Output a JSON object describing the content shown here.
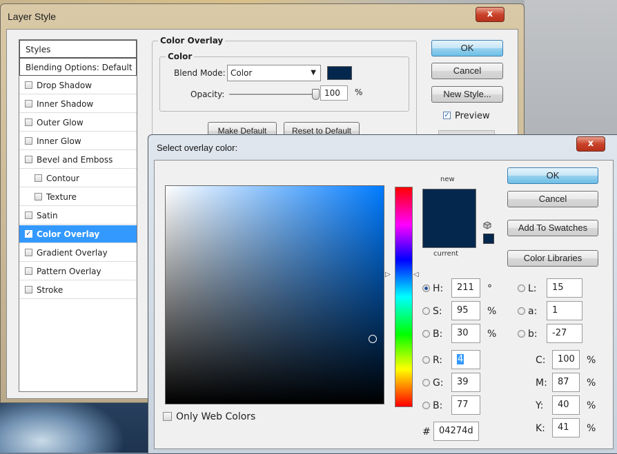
{
  "layer_style": {
    "title": "Layer Style",
    "close_label": "x",
    "styles": [
      {
        "label": "Styles",
        "checkbox": false,
        "checked": false,
        "indent": false,
        "header": true
      },
      {
        "label": "Blending Options: Default",
        "checkbox": false,
        "checked": false,
        "indent": false,
        "header": true
      },
      {
        "label": "Drop Shadow",
        "checkbox": true,
        "checked": false,
        "indent": false
      },
      {
        "label": "Inner Shadow",
        "checkbox": true,
        "checked": false,
        "indent": false
      },
      {
        "label": "Outer Glow",
        "checkbox": true,
        "checked": false,
        "indent": false
      },
      {
        "label": "Inner Glow",
        "checkbox": true,
        "checked": false,
        "indent": false
      },
      {
        "label": "Bevel and Emboss",
        "checkbox": true,
        "checked": false,
        "indent": false
      },
      {
        "label": "Contour",
        "checkbox": true,
        "checked": false,
        "indent": true
      },
      {
        "label": "Texture",
        "checkbox": true,
        "checked": false,
        "indent": true
      },
      {
        "label": "Satin",
        "checkbox": true,
        "checked": false,
        "indent": false
      },
      {
        "label": "Color Overlay",
        "checkbox": true,
        "checked": true,
        "indent": false,
        "active": true
      },
      {
        "label": "Gradient Overlay",
        "checkbox": true,
        "checked": false,
        "indent": false
      },
      {
        "label": "Pattern Overlay",
        "checkbox": true,
        "checked": false,
        "indent": false
      },
      {
        "label": "Stroke",
        "checkbox": true,
        "checked": false,
        "indent": false
      }
    ],
    "section_title": "Color Overlay",
    "group_title": "Color",
    "blend_mode_label": "Blend Mode:",
    "blend_mode_value": "Color",
    "opacity_label": "Opacity:",
    "opacity_value": "100",
    "opacity_unit": "%",
    "opacity_fraction": 1.0,
    "make_default": "Make Default",
    "reset_default": "Reset to Default",
    "ok": "OK",
    "cancel": "Cancel",
    "new_style": "New Style...",
    "preview_label": "Preview",
    "preview_checked": true,
    "overlay_color": "#04274d"
  },
  "color_picker": {
    "title": "Select overlay color:",
    "close_label": "x",
    "new_label": "new",
    "current_label": "current",
    "ok": "OK",
    "cancel": "Cancel",
    "add_to_swatches": "Add To Swatches",
    "color_libraries": "Color Libraries",
    "only_web_colors": "Only Web Colors",
    "hsb": [
      {
        "label": "H:",
        "value": "211",
        "unit": "°",
        "selected": true
      },
      {
        "label": "S:",
        "value": "95",
        "unit": "%",
        "selected": false
      },
      {
        "label": "B:",
        "value": "30",
        "unit": "%",
        "selected": false
      }
    ],
    "rgb": [
      {
        "label": "R:",
        "value": "4",
        "selected": false
      },
      {
        "label": "G:",
        "value": "39",
        "selected": false
      },
      {
        "label": "B:",
        "value": "77",
        "selected": false
      }
    ],
    "lab": [
      {
        "label": "L:",
        "value": "15"
      },
      {
        "label": "a:",
        "value": "1"
      },
      {
        "label": "b:",
        "value": "-27"
      }
    ],
    "cmyk": [
      {
        "label": "C:",
        "value": "100",
        "unit": "%"
      },
      {
        "label": "M:",
        "value": "87",
        "unit": "%"
      },
      {
        "label": "Y:",
        "value": "40",
        "unit": "%"
      },
      {
        "label": "K:",
        "value": "41",
        "unit": "%"
      }
    ],
    "hex_label": "#",
    "hex_value": "04274d",
    "new_color": "#04274d",
    "current_color": "#04274d"
  }
}
